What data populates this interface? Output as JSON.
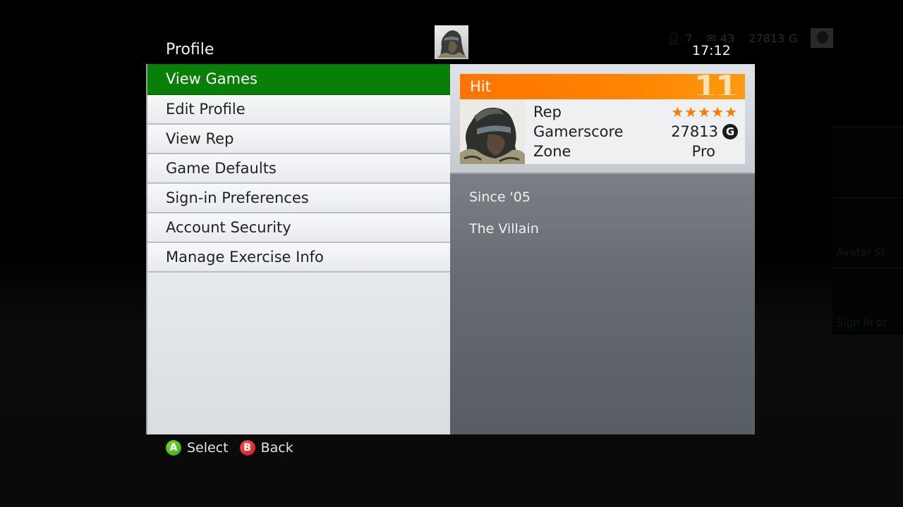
{
  "header": {
    "title": "Profile",
    "clock": "17:12",
    "status": {
      "friends_icon": "friends-icon",
      "friends_count": "7",
      "messages_icon": "envelope-icon",
      "messages_count": "43",
      "gamerscore": "27813",
      "gamerscore_icon": "G"
    }
  },
  "menu": {
    "items": [
      {
        "label": "View Games",
        "selected": true
      },
      {
        "label": "Edit Profile"
      },
      {
        "label": "View Rep"
      },
      {
        "label": "Game Defaults"
      },
      {
        "label": "Sign-in Preferences"
      },
      {
        "label": "Account Security"
      },
      {
        "label": "Manage Exercise Info"
      }
    ]
  },
  "gamercard": {
    "motto": "Hit",
    "level": "11",
    "rep_label": "Rep",
    "rep_stars": "★★★★★",
    "rep_value": 5,
    "rep_max": 5,
    "gamerscore_label": "Gamerscore",
    "gamerscore_value": "27813",
    "gamerscore_icon": "G",
    "zone_label": "Zone",
    "zone_value": "Pro"
  },
  "bio": {
    "since": "Since '05",
    "name": "The Villain"
  },
  "footer": {
    "a_glyph": "A",
    "a_label": "Select",
    "b_glyph": "B",
    "b_label": "Back"
  },
  "background_tiles": [
    "",
    "Avatar St",
    "Sign In or"
  ],
  "colors": {
    "selected": "#088008",
    "gamercard_header": "#ff7a00",
    "star": "#ff7a00",
    "button_a": "#2e9a10",
    "button_b": "#b81010"
  }
}
